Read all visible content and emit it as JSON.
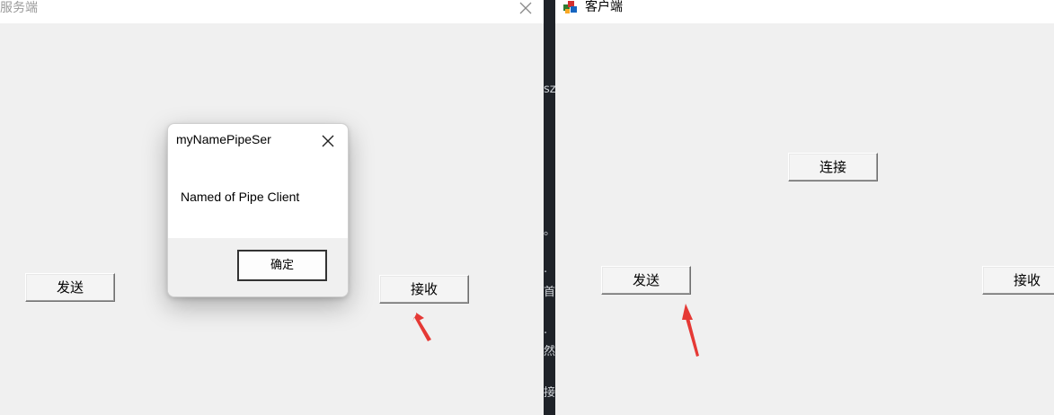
{
  "server_window": {
    "title": "服务端",
    "send_button": "发送",
    "receive_button": "接收",
    "close_icon": "close-icon"
  },
  "message_box": {
    "title": "myNamePipeSer",
    "message": "Named of Pipe Client",
    "ok_button": "确定",
    "close_icon": "close-icon"
  },
  "background_fragments": [
    "sz",
    "。",
    "·",
    "首",
    "·",
    "然",
    "接"
  ],
  "client_window": {
    "title": "客户端",
    "connect_button": "连接",
    "send_button": "发送",
    "receive_button": "接收",
    "app_icon": "app-icon"
  },
  "annotations": {
    "arrow_color": "#e53935"
  }
}
